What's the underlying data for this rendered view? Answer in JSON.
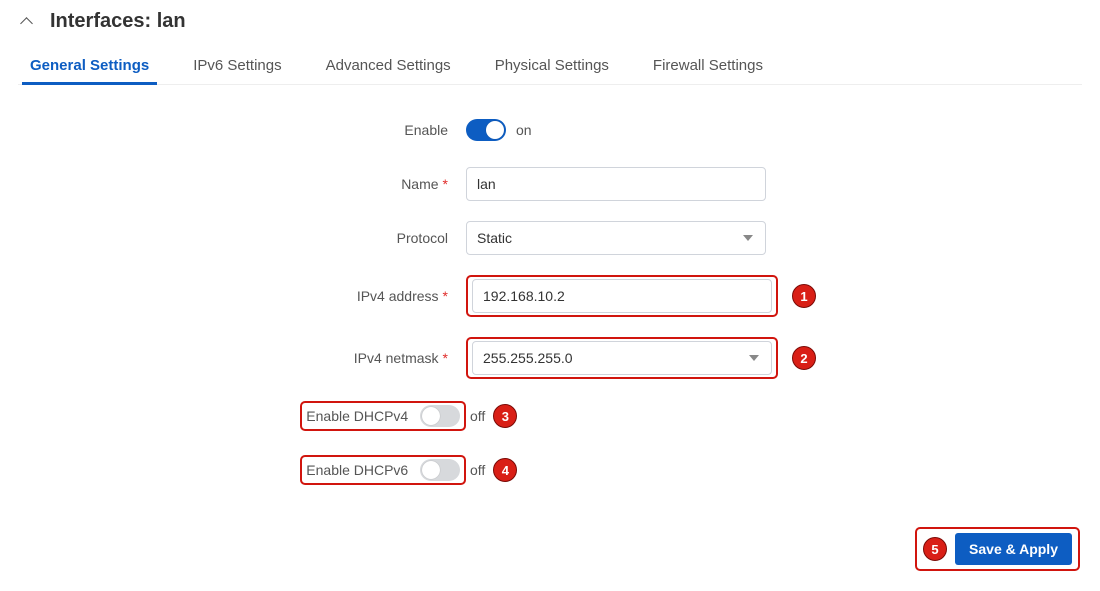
{
  "header": {
    "title": "Interfaces: lan"
  },
  "tabs": [
    {
      "label": "General Settings"
    },
    {
      "label": "IPv6 Settings"
    },
    {
      "label": "Advanced Settings"
    },
    {
      "label": "Physical Settings"
    },
    {
      "label": "Firewall Settings"
    }
  ],
  "form": {
    "enable": {
      "label": "Enable",
      "state_text": "on"
    },
    "name": {
      "label": "Name",
      "value": "lan"
    },
    "protocol": {
      "label": "Protocol",
      "value": "Static"
    },
    "ipv4_address": {
      "label": "IPv4 address",
      "value": "192.168.10.2"
    },
    "ipv4_netmask": {
      "label": "IPv4 netmask",
      "value": "255.255.255.0"
    },
    "dhcpv4": {
      "label": "Enable DHCPv4",
      "state_text": "off"
    },
    "dhcpv6": {
      "label": "Enable DHCPv6",
      "state_text": "off"
    }
  },
  "callouts": {
    "c1": "1",
    "c2": "2",
    "c3": "3",
    "c4": "4",
    "c5": "5"
  },
  "footer": {
    "save_apply": "Save & Apply"
  },
  "required_marker": "*"
}
